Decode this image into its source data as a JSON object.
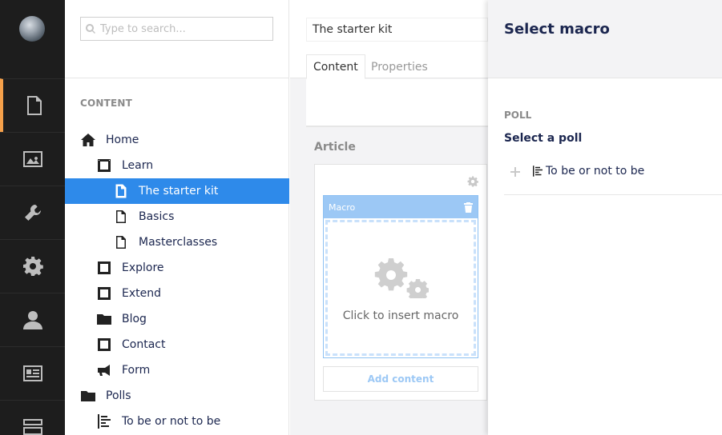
{
  "rail": {
    "sections": [
      "content-icon",
      "media-icon",
      "settings-wrench-icon",
      "gear-icon",
      "user-icon",
      "contact-card-icon",
      "forms-icon"
    ],
    "active_color": "#f5a04a"
  },
  "tree": {
    "search_placeholder": "Type to search...",
    "heading": "CONTENT",
    "nodes": [
      {
        "label": "Home",
        "icon": "home-icon"
      },
      {
        "label": "Learn",
        "icon": "frame-icon"
      },
      {
        "label": "The starter kit",
        "icon": "document-icon"
      },
      {
        "label": "Basics",
        "icon": "document-icon"
      },
      {
        "label": "Masterclasses",
        "icon": "document-icon"
      },
      {
        "label": "Explore",
        "icon": "frame-icon"
      },
      {
        "label": "Extend",
        "icon": "frame-icon"
      },
      {
        "label": "Blog",
        "icon": "folder-icon"
      },
      {
        "label": "Contact",
        "icon": "frame-icon"
      },
      {
        "label": "Form",
        "icon": "megaphone-icon"
      },
      {
        "label": "Polls",
        "icon": "folder-icon"
      },
      {
        "label": "To be or not to be",
        "icon": "list-icon"
      }
    ],
    "selected_color": "#2e8aea"
  },
  "editor": {
    "name_value": "The starter kit",
    "tabs": [
      "Content",
      "Properties"
    ],
    "section_label": "Article",
    "macro_label": "Macro",
    "insert_macro_text": "Click to insert macro",
    "add_content_label": "Add content"
  },
  "overlay": {
    "title": "Select macro",
    "group_label": "POLL",
    "property_label": "Select a poll",
    "selected_item": "To be or not to be"
  }
}
